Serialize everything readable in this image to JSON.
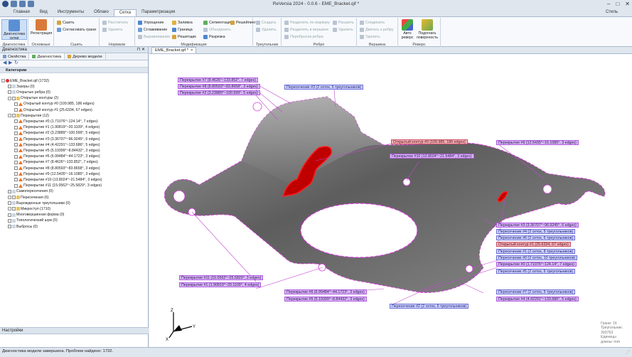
{
  "window": {
    "title": "ReVersia 2024 - 0.0.6 - EME_Bracket.qif *",
    "style_label": "Стиль"
  },
  "menu_tabs": [
    "Главная",
    "Вид",
    "Инструменты",
    "Облако",
    "Сетка",
    "Параметризация"
  ],
  "active_tab": "Сетка",
  "ribbon": {
    "diagnostics": {
      "big": "Диагностика сетки",
      "label": "Диагностика"
    },
    "basic": {
      "big": "Регистрация",
      "label": "Основные"
    },
    "sew": {
      "items": [
        "Сшить",
        "Согласовать грани"
      ],
      "label": "Сшить"
    },
    "normals": {
      "items": [
        "Рассчитать",
        "Удалить"
      ],
      "label": "Нормали"
    },
    "modify": {
      "items": [
        "Упрощение",
        "Сглаживание",
        "Выравнивание",
        "Заливка",
        "Граница",
        "Решетщик",
        "Сегментация",
        "Объединить",
        "Разрезка",
        "Решейпинг"
      ],
      "label": "Модификация"
    },
    "triangles": {
      "items": [
        "Создать",
        "Удалить"
      ],
      "label": "Треугольник"
    },
    "edges": {
      "items": [
        "Разделить по маркеру",
        "Разделить в вершине",
        "Переброска ребра",
        "Расшить",
        "Удалить"
      ],
      "label": "Ребро"
    },
    "vertex": {
      "items": [
        "Соединить",
        "Двигать к ребру",
        "Удалить"
      ],
      "label": "Вершина"
    },
    "reverse": {
      "big1": "Авто реверс",
      "big2": "Подогнать поверхность",
      "label": "Реверс"
    }
  },
  "left_panel": {
    "title": "Диагностика",
    "tabs": [
      "Свойства",
      "Диагностика",
      "Дерево модели"
    ],
    "category_header": "Категории",
    "tree": [
      {
        "text": "EME_Bracket.qif (1732)",
        "level": 0,
        "kind": "root"
      },
      {
        "text": "Зазоры (0)",
        "level": 1,
        "kind": "leaf"
      },
      {
        "text": "Открытые ребра (0)",
        "level": 1,
        "kind": "leaf"
      },
      {
        "text": "Открытые контуры (2)",
        "level": 1,
        "kind": "group"
      },
      {
        "text": "Открытый контур #0 (109.985, 186 edges)",
        "level": 2,
        "kind": "warn"
      },
      {
        "text": "Открытый контур #1 (25.6334, 67 edges)",
        "level": 2,
        "kind": "warn"
      },
      {
        "text": "Перекрытия (12)",
        "level": 1,
        "kind": "group"
      },
      {
        "text": "Перекрытие #0 (1.71076°~124.14°, 7 edges)",
        "level": 2,
        "kind": "warn"
      },
      {
        "text": "Перекрытие #1 (1.90819°~20.1109°, 4 edges)",
        "level": 2,
        "kind": "warn"
      },
      {
        "text": "Перекрытие #2 (3.23889°~100.599°, 5 edges)",
        "level": 2,
        "kind": "warn"
      },
      {
        "text": "Перекрытие #3 (3.36707°~96.9245°, 6 edges)",
        "level": 2,
        "kind": "warn"
      },
      {
        "text": "Перекрытие #4 (4.42291°~133.686°, 5 edges)",
        "level": 2,
        "kind": "warn"
      },
      {
        "text": "Перекрытие #5 (5.19399°~8.84432°, 3 edges)",
        "level": 2,
        "kind": "warn"
      },
      {
        "text": "Перекрытие #6 (6.99484°~44.1723°, 3 edges)",
        "level": 2,
        "kind": "warn"
      },
      {
        "text": "Перекрытие #7 (8.4626°~133.852°, 7 edges)",
        "level": 2,
        "kind": "warn"
      },
      {
        "text": "Перекрытие #8 (8.80593°~83.8658°, 3 edges)",
        "level": 2,
        "kind": "warn"
      },
      {
        "text": "Перекрытие #9 (12.5435°~16.1085°, 3 edges)",
        "level": 2,
        "kind": "warn"
      },
      {
        "text": "Перекрытие #10 (13.8024°~21.5484°, 3 edges)",
        "level": 2,
        "kind": "warn"
      },
      {
        "text": "Перекрытие #11 (15.0562°~25.5829°, 3 edges)",
        "level": 2,
        "kind": "warn"
      },
      {
        "text": "Самопересечения (0)",
        "level": 1,
        "kind": "leaf"
      },
      {
        "text": "Пересечения (6)",
        "level": 1,
        "kind": "group"
      },
      {
        "text": "Вырожденные треугольники (0)",
        "level": 1,
        "kind": "leaf"
      },
      {
        "text": "Микроступ (1710)",
        "level": 1,
        "kind": "group"
      },
      {
        "text": "Многовершинная форма (0)",
        "level": 1,
        "kind": "leaf"
      },
      {
        "text": "Топологический шум (0)",
        "level": 1,
        "kind": "leaf"
      },
      {
        "text": "Выбросы (0)",
        "level": 1,
        "kind": "leaf"
      }
    ],
    "settings_title": "Настройки"
  },
  "document_tab": "EME_Bracket.qif *",
  "viewport": {
    "labels": [
      {
        "text": "Перекрытие #7 (8.4626°~133.852°, 7 edges)",
        "kind": "overlap"
      },
      {
        "text": "Перекрытие #8 (8.80593°~83.8658°, 3 edges)",
        "kind": "overlap"
      },
      {
        "text": "Перекрытие #2 (3.23889°~100.599°, 5 edges)",
        "kind": "overlap"
      },
      {
        "text": "Пересечение #3 (2 сеток, 5 треугольников)",
        "kind": "inter"
      },
      {
        "text": "Открытый контур #0 (109.985, 186 edges)",
        "kind": "open"
      },
      {
        "text": "Перекрытие #10 (13.8024°~21.5484°, 3 edges)",
        "kind": "overlap"
      },
      {
        "text": "Перекрытие #9 (12.5435°~16.1085°, 3 edges)",
        "kind": "overlap"
      },
      {
        "text": "Перекрытие #3 (3.36707°~96.9245°, 6 edges)",
        "kind": "overlap"
      },
      {
        "text": "Пересечение #4 (2 сеток, 5 треугольников)",
        "kind": "inter"
      },
      {
        "text": "Пересечение #6 (2 сеток, 6 треугольников)",
        "kind": "inter"
      },
      {
        "text": "Открытый контур #1 (25.6334, 67 edges)",
        "kind": "open"
      },
      {
        "text": "Пересечение #1 (2 сеток, 8 треугольников)",
        "kind": "inter"
      },
      {
        "text": "Пересечение #0 (2 сеток, 10 треугольников)",
        "kind": "inter"
      },
      {
        "text": "Перекрытие #0 (1.71076°~124.14°, 7 edges)",
        "kind": "overlap"
      },
      {
        "text": "Пересечение #5 (2 сеток, 6 треугольников)",
        "kind": "inter"
      },
      {
        "text": "Перекрытие #11 (15.0562°~25.5829°, 3 edges)",
        "kind": "overlap"
      },
      {
        "text": "Перекрытие #1 (1.90819°~20.1109°, 4 edges)",
        "kind": "overlap"
      },
      {
        "text": "Перекрытие #6 (6.99484°~44.1723°, 3 edges)",
        "kind": "overlap"
      },
      {
        "text": "Перекрытие #5 (5.19399°~8.84432°, 3 edges)",
        "kind": "overlap"
      },
      {
        "text": "Пересечение #2 (2 сеток, 6 треугольников)",
        "kind": "inter"
      },
      {
        "text": "Пересечение #7 (2 сеток, 5 треугольников)",
        "kind": "inter"
      },
      {
        "text": "Перекрытие #4 (4.42291°~133.686°, 5 edges)",
        "kind": "overlap"
      }
    ],
    "stats": [
      "Грани: 16",
      "Треугольник: 393763",
      "Единицы длины: mm"
    ],
    "axes": {
      "x": "X",
      "y": "Y",
      "z": "Z"
    }
  },
  "status": "Диагностика модели завершена. Проблем найдено: 1732.",
  "colors": {
    "overlap": "#d9b7f5",
    "open": "#f3b1b7",
    "inter": "#cfd3ff",
    "edge_highlight": "#d23bd6"
  }
}
